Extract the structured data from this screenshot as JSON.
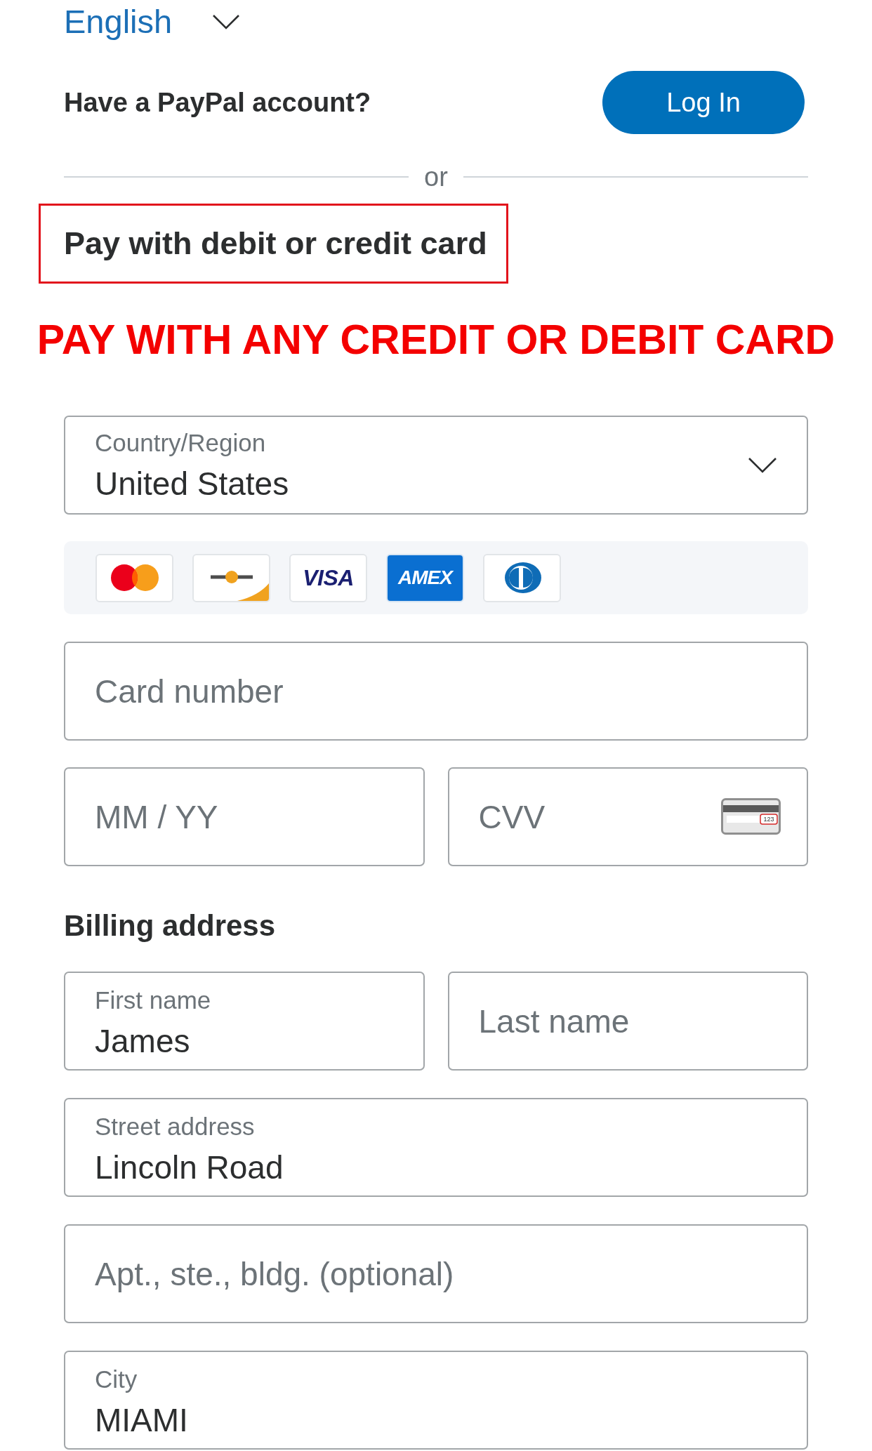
{
  "language": {
    "label": "English"
  },
  "account": {
    "prompt": "Have a PayPal account?",
    "button": "Log In"
  },
  "divider": {
    "label": "or"
  },
  "card_option": {
    "label": "Pay with debit or credit card",
    "highlighted": true
  },
  "banner": {
    "text": "PAY WITH ANY CREDIT OR DEBIT CARD"
  },
  "country": {
    "label": "Country/Region",
    "value": "United States"
  },
  "card_brands": [
    {
      "kind": "circles"
    },
    {
      "kind": "dotline"
    },
    {
      "kind": "visa",
      "text": "VISA"
    },
    {
      "kind": "amex",
      "text": "AMEX"
    },
    {
      "kind": "ring"
    }
  ],
  "card_details": {
    "card_number": {
      "placeholder": "Card number"
    },
    "expiry": {
      "placeholder": "MM / YY"
    },
    "cvv": {
      "placeholder": "CVV",
      "icon_text": "123"
    }
  },
  "billing_address": {
    "title": "Billing address",
    "first_name": {
      "label": "First name",
      "value": "James"
    },
    "last_name": {
      "placeholder": "Last name"
    },
    "street": {
      "label": "Street address",
      "value": "Lincoln Road"
    },
    "apartment": {
      "placeholder": "Apt., ste., bldg. (optional)"
    },
    "city": {
      "label": "City",
      "value": "MIAMI"
    }
  }
}
